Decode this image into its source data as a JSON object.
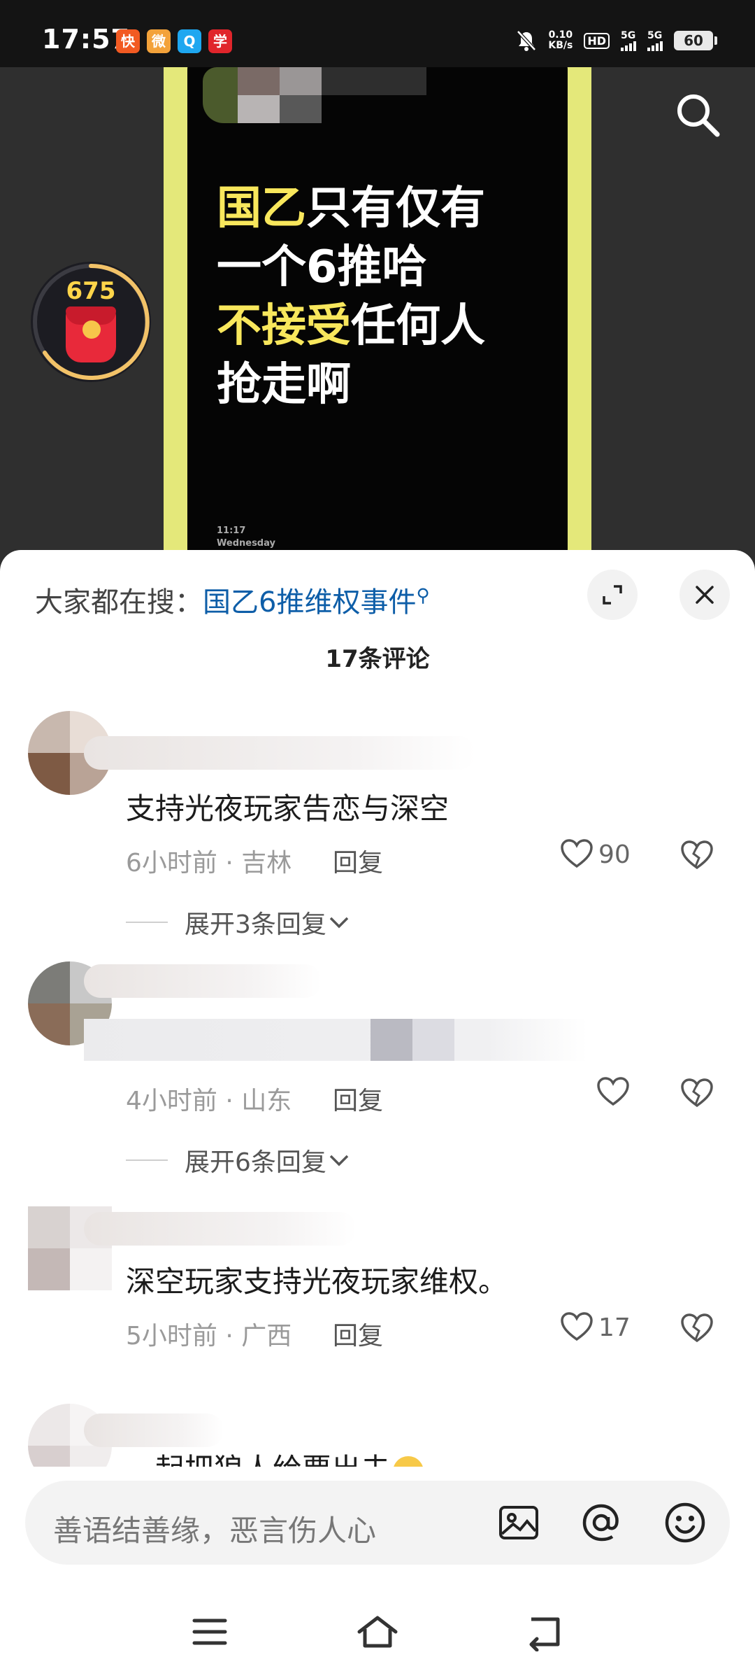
{
  "status_bar": {
    "time": "17:57",
    "net_speed_value": "0.10",
    "net_speed_unit": "KB/s",
    "hd": "HD",
    "sim1": "5G",
    "sim2": "5G",
    "battery": "60"
  },
  "video": {
    "poster_lines": [
      {
        "highlight": "国乙",
        "rest": "只有仅有"
      },
      {
        "highlight": "",
        "rest": "一个6推哈"
      },
      {
        "highlight": "不接受",
        "rest": "任何人"
      },
      {
        "highlight": "",
        "rest": "抢走啊"
      }
    ],
    "poster_time": "11:17",
    "poster_day": "Wednesday",
    "red_packet_count": "675"
  },
  "sheet": {
    "hot_search_prefix": "大家都在搜：",
    "hot_search_keyword": "国乙6推维权事件",
    "comment_count": "17条评论"
  },
  "comments": [
    {
      "text": "支持光夜玩家告恋与深空",
      "meta": "6小时前 · 吉林",
      "reply_label": "回复",
      "likes": "90",
      "expand": "展开3条回复"
    },
    {
      "text": "",
      "meta": "4小时前 · 山东",
      "reply_label": "回复",
      "likes": "",
      "expand": "展开6条回复"
    },
    {
      "text": "深空玩家支持光夜玩家维权。",
      "meta": "5小时前 · 广西",
      "reply_label": "回复",
      "likes": "17",
      "expand": ""
    },
    {
      "text": "一起把狼人给票出去",
      "meta": "",
      "reply_label": "",
      "likes": "",
      "expand": ""
    }
  ],
  "input": {
    "placeholder": "善语结善缘，恶言伤人心"
  },
  "colors": {
    "poster_highlight": "#f8e75c",
    "poster_frame": "#e4e87a",
    "keyword_link": "#0e5ea8",
    "red_packet": "#e8293a"
  },
  "icons": [
    "search-icon",
    "red-packet-icon",
    "expand-icon",
    "close-icon",
    "heart-icon",
    "broken-heart-icon",
    "chevron-down-icon",
    "image-icon",
    "at-icon",
    "emoji-icon",
    "menu-icon",
    "home-icon",
    "back-icon"
  ]
}
